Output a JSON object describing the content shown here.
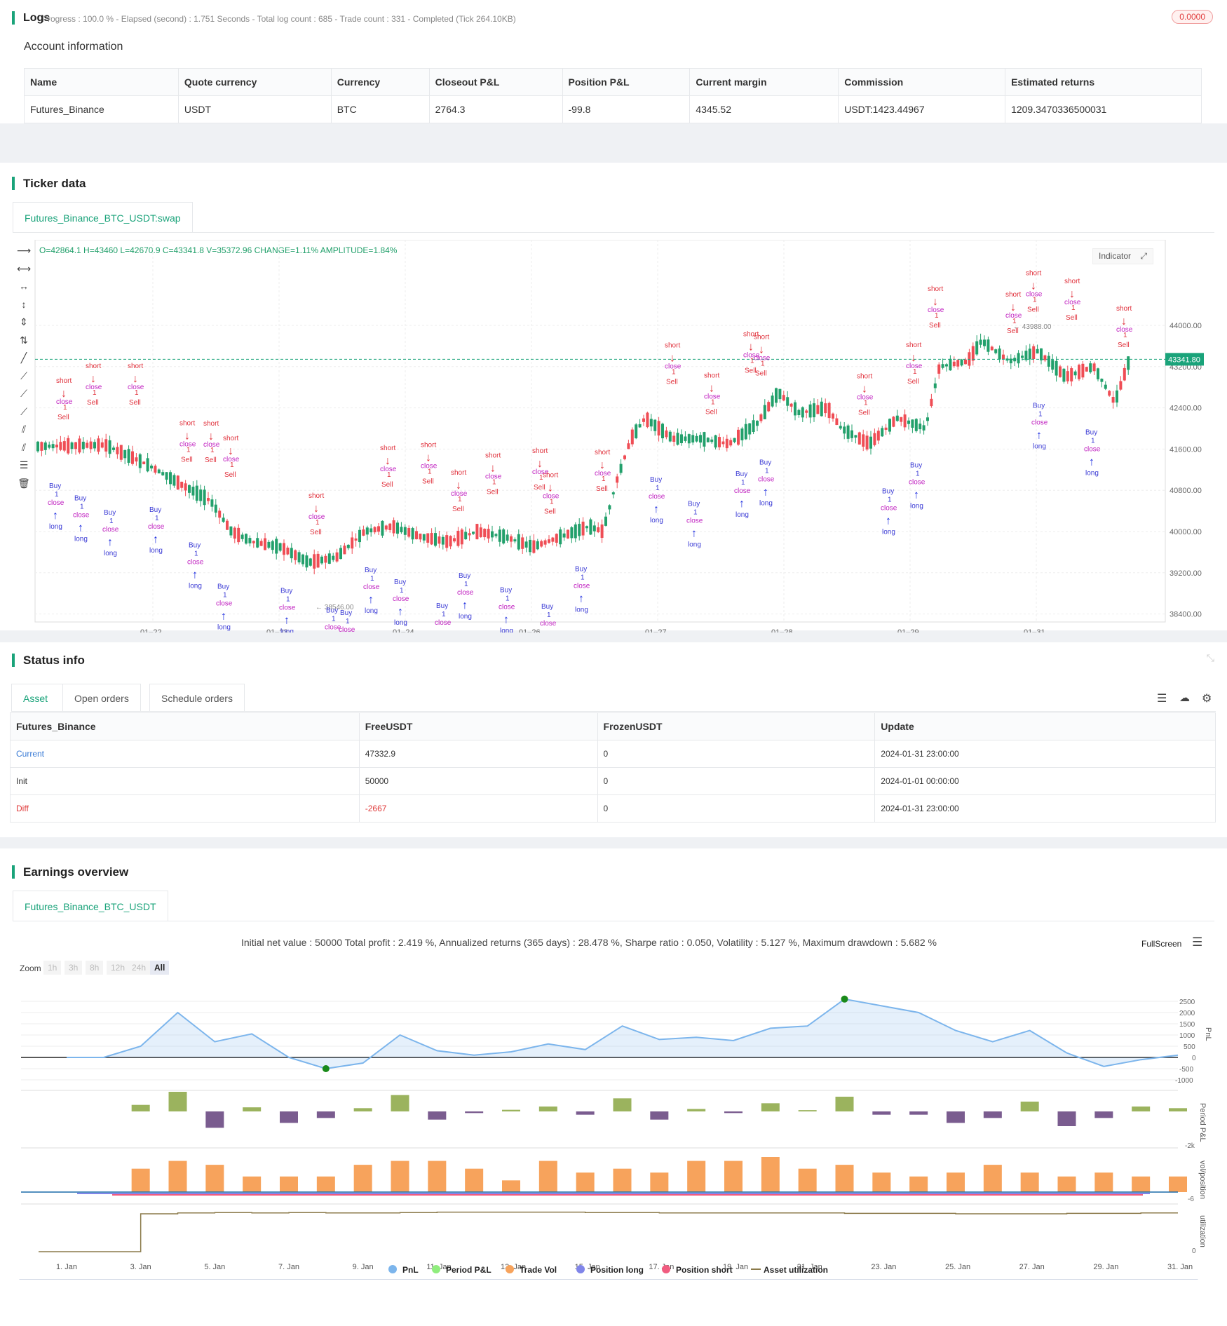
{
  "logs": {
    "title": "Logs",
    "progress_text": "Progress : 100.0 % - Elapsed (second) : 1.751  Seconds - Total log count : 685 - Trade count : 331 - Completed (Tick 264.10KB)",
    "badge": "0.0000"
  },
  "account": {
    "title": "Account information",
    "columns": [
      "Name",
      "Quote currency",
      "Currency",
      "Closeout P&L",
      "Position P&L",
      "Current margin",
      "Commission",
      "Estimated returns"
    ],
    "row": [
      "Futures_Binance",
      "USDT",
      "BTC",
      "2764.3",
      "-99.8",
      "4345.52",
      "USDT:1423.44967",
      "1209.3470336500031"
    ]
  },
  "ticker": {
    "title": "Ticker data",
    "tab": "Futures_Binance_BTC_USDT:swap",
    "ohlc_text": "O=42864.1 H=43460 L=42670.9 C=43341.8 V=35372.96 CHANGE=1.11% AMPLITUDE=1.84%",
    "indicator_label": "Indicator",
    "last_price": "43341.80",
    "high_marker": "43988.00",
    "low_marker": "38546.00",
    "y_ticks": [
      "44000.00",
      "43200.00",
      "42400.00",
      "41600.00",
      "40800.00",
      "40000.00",
      "39200.00",
      "38400.00"
    ],
    "x_ticks": [
      "01–22",
      "01–23",
      "01–24",
      "01–26",
      "01–27",
      "01–28",
      "01–29",
      "01–31"
    ],
    "up_color": "#22a06b",
    "down_color": "#ef4d55",
    "signal_labels": {
      "short": "short",
      "long": "long",
      "close": "close",
      "buy": "Buy",
      "sell": "Sell",
      "one": "1"
    }
  },
  "status": {
    "title": "Status info",
    "tabs": [
      "Asset",
      "Open orders",
      "Schedule orders"
    ],
    "columns": [
      "Futures_Binance",
      "FreeUSDT",
      "FrozenUSDT",
      "Update"
    ],
    "rows": [
      [
        "Current",
        "47332.9",
        "0",
        "2024-01-31 23:00:00"
      ],
      [
        "Init",
        "50000",
        "0",
        "2024-01-01 00:00:00"
      ],
      [
        "Diff",
        "-2667",
        "0",
        "2024-01-31 23:00:00"
      ]
    ]
  },
  "earnings": {
    "title": "Earnings overview",
    "tab": "Futures_Binance_BTC_USDT",
    "summary": "Initial net value : 50000 Total profit : 2.419 %, Annualized returns (365 days) : 28.478 %, Sharpe ratio : 0.050, Volatility : 5.127 %, Maximum drawdown : 5.682 %",
    "fullscreen": "FullScreen",
    "zoom_label": "Zoom",
    "zoom_buttons": [
      "1h",
      "3h",
      "8h",
      "12h",
      "24h",
      "All"
    ],
    "pnl_ticks": [
      "2500",
      "2000",
      "1500",
      "1000",
      "500",
      "0",
      "-500",
      "-1000"
    ],
    "axis_labels": [
      "PnL",
      "Period P&L",
      "vol/position",
      "utilization"
    ],
    "period_tick": "-2k",
    "vol_tick": "-6",
    "util_tick": "0",
    "x_dates": [
      "1. Jan",
      "3. Jan",
      "5. Jan",
      "7. Jan",
      "9. Jan",
      "11. Jan",
      "13. Jan",
      "15. Jan",
      "17. Jan",
      "19. Jan",
      "21. Jan",
      "23. Jan",
      "25. Jan",
      "27. Jan",
      "29. Jan",
      "31. Jan"
    ],
    "legend": [
      "PnL",
      "Period P&L",
      "Trade Vol",
      "Position long",
      "Position short",
      "Asset utilization"
    ],
    "legend_colors": [
      "#7cb5ec",
      "#90ed7d",
      "#f7a35c",
      "#8085e9",
      "#f15c80",
      "#8b7a4a"
    ],
    "chart_data": {
      "type": "area",
      "x": [
        "1. Jan",
        "2. Jan",
        "3. Jan",
        "4. Jan",
        "5. Jan",
        "6. Jan",
        "7. Jan",
        "8. Jan",
        "9. Jan",
        "10. Jan",
        "11. Jan",
        "12. Jan",
        "13. Jan",
        "14. Jan",
        "15. Jan",
        "16. Jan",
        "17. Jan",
        "18. Jan",
        "19. Jan",
        "20. Jan",
        "21. Jan",
        "22. Jan",
        "23. Jan",
        "24. Jan",
        "25. Jan",
        "26. Jan",
        "27. Jan",
        "28. Jan",
        "29. Jan",
        "30. Jan",
        "31. Jan"
      ],
      "series": [
        {
          "name": "PnL",
          "values": [
            0,
            0,
            500,
            2000,
            700,
            1050,
            0,
            -500,
            -250,
            1000,
            300,
            100,
            250,
            600,
            350,
            1400,
            800,
            900,
            750,
            1300,
            1400,
            2600,
            2300,
            2000,
            1200,
            700,
            1200,
            200,
            -400,
            -100,
            100,
            1200
          ]
        },
        {
          "name": "Period P&L",
          "values": [
            0,
            0,
            400,
            1200,
            -1000,
            250,
            -700,
            -400,
            200,
            1000,
            -500,
            -100,
            100,
            300,
            -200,
            800,
            -500,
            150,
            -100,
            500,
            80,
            900,
            -200,
            -200,
            -700,
            -400,
            600,
            -900,
            -400,
            300,
            200,
            800
          ]
        },
        {
          "name": "Trade Vol",
          "values": [
            0,
            0,
            6,
            8,
            7,
            4,
            4,
            4,
            7,
            8,
            8,
            6,
            3,
            8,
            5,
            6,
            5,
            8,
            8,
            9,
            6,
            7,
            5,
            4,
            5,
            7,
            5,
            4,
            5,
            4,
            4
          ]
        },
        {
          "name": "Asset utilization",
          "values": [
            0,
            0,
            0.9,
            0.92,
            0.93,
            0.92,
            0.93,
            0.92,
            0.92,
            0.93,
            0.94,
            0.94,
            0.94,
            0.94,
            0.93,
            0.93,
            0.92,
            0.92,
            0.92,
            0.92,
            0.92,
            0.91,
            0.91,
            0.91,
            0.9,
            0.9,
            0.9,
            0.91,
            0.91,
            0.92,
            0.92,
            0.92
          ]
        }
      ],
      "pnl_ylim": [
        -1000,
        2500
      ]
    }
  }
}
